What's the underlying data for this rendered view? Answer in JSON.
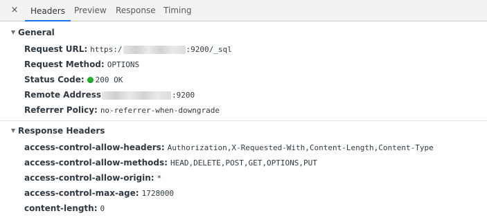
{
  "tabs": {
    "close_glyph": "×",
    "items": [
      {
        "label": "Headers",
        "active": true
      },
      {
        "label": "Preview",
        "active": false
      },
      {
        "label": "Response",
        "active": false
      },
      {
        "label": "Timing",
        "active": false
      }
    ]
  },
  "general": {
    "title": "General",
    "request_url": {
      "key": "Request URL:",
      "value_prefix": "https:/",
      "value_suffix": ":9200/_sql"
    },
    "request_method": {
      "key": "Request Method:",
      "value": "OPTIONS"
    },
    "status_code": {
      "key": "Status Code:",
      "value": "200 OK",
      "color": "#21b529"
    },
    "remote_address": {
      "key": "Remote Address",
      "value_suffix": ":9200"
    },
    "referrer_policy": {
      "key": "Referrer Policy:",
      "value": "no-referrer-when-downgrade"
    }
  },
  "response_headers": {
    "title": "Response Headers",
    "items": [
      {
        "key": "access-control-allow-headers:",
        "value": "Authorization,X-Requested-With,Content-Length,Content-Type"
      },
      {
        "key": "access-control-allow-methods:",
        "value": "HEAD,DELETE,POST,GET,OPTIONS,PUT"
      },
      {
        "key": "access-control-allow-origin:",
        "value": "*"
      },
      {
        "key": "access-control-max-age:",
        "value": "1728000"
      },
      {
        "key": "content-length:",
        "value": "0"
      }
    ]
  },
  "colors": {
    "accent": "#1a73e8",
    "status_ok": "#21b529"
  }
}
